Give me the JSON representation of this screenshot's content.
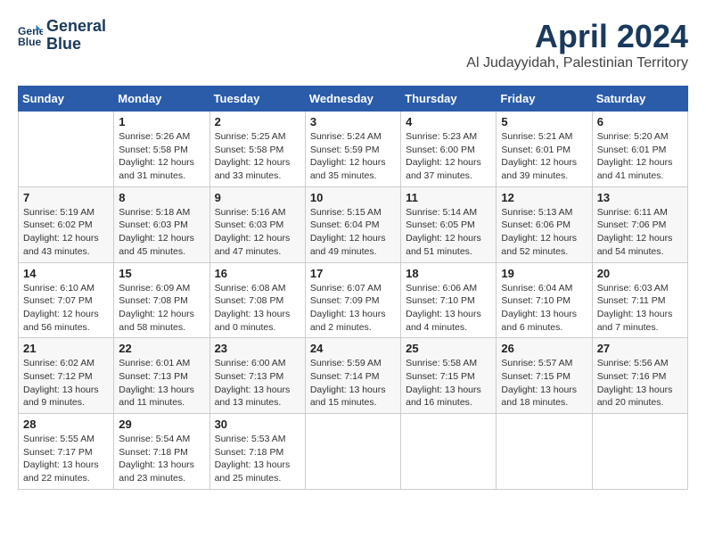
{
  "logo": {
    "line1": "General",
    "line2": "Blue"
  },
  "title": "April 2024",
  "location": "Al Judayyidah, Palestinian Territory",
  "days_of_week": [
    "Sunday",
    "Monday",
    "Tuesday",
    "Wednesday",
    "Thursday",
    "Friday",
    "Saturday"
  ],
  "weeks": [
    [
      {
        "day": "",
        "content": ""
      },
      {
        "day": "1",
        "content": "Sunrise: 5:26 AM\nSunset: 5:58 PM\nDaylight: 12 hours\nand 31 minutes."
      },
      {
        "day": "2",
        "content": "Sunrise: 5:25 AM\nSunset: 5:58 PM\nDaylight: 12 hours\nand 33 minutes."
      },
      {
        "day": "3",
        "content": "Sunrise: 5:24 AM\nSunset: 5:59 PM\nDaylight: 12 hours\nand 35 minutes."
      },
      {
        "day": "4",
        "content": "Sunrise: 5:23 AM\nSunset: 6:00 PM\nDaylight: 12 hours\nand 37 minutes."
      },
      {
        "day": "5",
        "content": "Sunrise: 5:21 AM\nSunset: 6:01 PM\nDaylight: 12 hours\nand 39 minutes."
      },
      {
        "day": "6",
        "content": "Sunrise: 5:20 AM\nSunset: 6:01 PM\nDaylight: 12 hours\nand 41 minutes."
      }
    ],
    [
      {
        "day": "7",
        "content": "Sunrise: 5:19 AM\nSunset: 6:02 PM\nDaylight: 12 hours\nand 43 minutes."
      },
      {
        "day": "8",
        "content": "Sunrise: 5:18 AM\nSunset: 6:03 PM\nDaylight: 12 hours\nand 45 minutes."
      },
      {
        "day": "9",
        "content": "Sunrise: 5:16 AM\nSunset: 6:03 PM\nDaylight: 12 hours\nand 47 minutes."
      },
      {
        "day": "10",
        "content": "Sunrise: 5:15 AM\nSunset: 6:04 PM\nDaylight: 12 hours\nand 49 minutes."
      },
      {
        "day": "11",
        "content": "Sunrise: 5:14 AM\nSunset: 6:05 PM\nDaylight: 12 hours\nand 51 minutes."
      },
      {
        "day": "12",
        "content": "Sunrise: 5:13 AM\nSunset: 6:06 PM\nDaylight: 12 hours\nand 52 minutes."
      },
      {
        "day": "13",
        "content": "Sunrise: 6:11 AM\nSunset: 7:06 PM\nDaylight: 12 hours\nand 54 minutes."
      }
    ],
    [
      {
        "day": "14",
        "content": "Sunrise: 6:10 AM\nSunset: 7:07 PM\nDaylight: 12 hours\nand 56 minutes."
      },
      {
        "day": "15",
        "content": "Sunrise: 6:09 AM\nSunset: 7:08 PM\nDaylight: 12 hours\nand 58 minutes."
      },
      {
        "day": "16",
        "content": "Sunrise: 6:08 AM\nSunset: 7:08 PM\nDaylight: 13 hours\nand 0 minutes."
      },
      {
        "day": "17",
        "content": "Sunrise: 6:07 AM\nSunset: 7:09 PM\nDaylight: 13 hours\nand 2 minutes."
      },
      {
        "day": "18",
        "content": "Sunrise: 6:06 AM\nSunset: 7:10 PM\nDaylight: 13 hours\nand 4 minutes."
      },
      {
        "day": "19",
        "content": "Sunrise: 6:04 AM\nSunset: 7:10 PM\nDaylight: 13 hours\nand 6 minutes."
      },
      {
        "day": "20",
        "content": "Sunrise: 6:03 AM\nSunset: 7:11 PM\nDaylight: 13 hours\nand 7 minutes."
      }
    ],
    [
      {
        "day": "21",
        "content": "Sunrise: 6:02 AM\nSunset: 7:12 PM\nDaylight: 13 hours\nand 9 minutes."
      },
      {
        "day": "22",
        "content": "Sunrise: 6:01 AM\nSunset: 7:13 PM\nDaylight: 13 hours\nand 11 minutes."
      },
      {
        "day": "23",
        "content": "Sunrise: 6:00 AM\nSunset: 7:13 PM\nDaylight: 13 hours\nand 13 minutes."
      },
      {
        "day": "24",
        "content": "Sunrise: 5:59 AM\nSunset: 7:14 PM\nDaylight: 13 hours\nand 15 minutes."
      },
      {
        "day": "25",
        "content": "Sunrise: 5:58 AM\nSunset: 7:15 PM\nDaylight: 13 hours\nand 16 minutes."
      },
      {
        "day": "26",
        "content": "Sunrise: 5:57 AM\nSunset: 7:15 PM\nDaylight: 13 hours\nand 18 minutes."
      },
      {
        "day": "27",
        "content": "Sunrise: 5:56 AM\nSunset: 7:16 PM\nDaylight: 13 hours\nand 20 minutes."
      }
    ],
    [
      {
        "day": "28",
        "content": "Sunrise: 5:55 AM\nSunset: 7:17 PM\nDaylight: 13 hours\nand 22 minutes."
      },
      {
        "day": "29",
        "content": "Sunrise: 5:54 AM\nSunset: 7:18 PM\nDaylight: 13 hours\nand 23 minutes."
      },
      {
        "day": "30",
        "content": "Sunrise: 5:53 AM\nSunset: 7:18 PM\nDaylight: 13 hours\nand 25 minutes."
      },
      {
        "day": "",
        "content": ""
      },
      {
        "day": "",
        "content": ""
      },
      {
        "day": "",
        "content": ""
      },
      {
        "day": "",
        "content": ""
      }
    ]
  ]
}
